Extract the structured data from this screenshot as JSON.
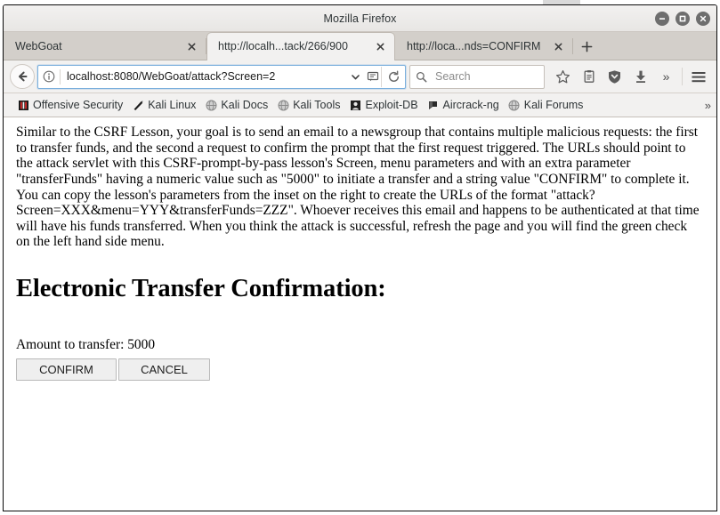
{
  "window": {
    "title": "Mozilla Firefox",
    "controls": [
      {
        "name": "minimize",
        "glyph": "minimize-icon"
      },
      {
        "name": "maximize",
        "glyph": "maximize-icon"
      },
      {
        "name": "close",
        "glyph": "close-icon"
      }
    ]
  },
  "tabs": [
    {
      "label": "WebGoat",
      "active": false,
      "close": "×"
    },
    {
      "label": "http://localh...tack/266/900",
      "active": true,
      "close": "×"
    },
    {
      "label": "http://loca...nds=CONFIRM",
      "active": false,
      "close": "×"
    }
  ],
  "new_tab_label": "+",
  "navigation": {
    "back_icon": "back-arrow-icon",
    "identity_icon": "info-icon",
    "url_value": "localhost:8080/WebGoat/attack?Screen=2",
    "url_dropdown_icon": "chevron-down-icon",
    "url_page_action_icon": "page-action-icon",
    "reload_icon": "reload-icon",
    "search_placeholder": "Search",
    "search_icon": "search-icon",
    "bookmark_icon": "star-icon",
    "library_icon": "library-icon",
    "sync_icon": "shield-down-icon",
    "downloads_icon": "download-arrow-icon",
    "overflow_icon": "»",
    "menu_icon": "hamburger-menu-icon"
  },
  "bookmarks": {
    "items": [
      {
        "label": "Offensive Security",
        "icon": "offsec-icon"
      },
      {
        "label": "Kali Linux",
        "icon": "kali-dragon-icon"
      },
      {
        "label": "Kali Docs",
        "icon": "globe-icon"
      },
      {
        "label": "Kali Tools",
        "icon": "globe-icon"
      },
      {
        "label": "Exploit-DB",
        "icon": "exploitdb-icon"
      },
      {
        "label": "Aircrack-ng",
        "icon": "aircrack-icon"
      },
      {
        "label": "Kali Forums",
        "icon": "globe-icon"
      }
    ],
    "overflow": "»"
  },
  "page": {
    "lesson_description": "Similar to the CSRF Lesson, your goal is to send an email to a newsgroup that contains multiple malicious requests: the first to transfer funds, and the second a request to confirm the prompt that the first request triggered. The URLs should point to the attack servlet with this CSRF-prompt-by-pass lesson's Screen, menu parameters and with an extra parameter \"transferFunds\" having a numeric value such as \"5000\" to initiate a transfer and a string value \"CONFIRM\" to complete it. You can copy the lesson's parameters from the inset on the right to create the URLs of the format \"attack?Screen=XXX&menu=YYY&transferFunds=ZZZ\". Whoever receives this email and happens to be authenticated at that time will have his funds transferred. When you think the attack is successful, refresh the page and you will find the green check on the left hand side menu.",
    "heading": "Electronic Transfer Confirmation:",
    "amount_label": "Amount to transfer: 5000",
    "confirm_button": "CONFIRM",
    "cancel_button": "CANCEL"
  },
  "colors": {
    "chrome_bg": "#f2f1f0",
    "tabstrip_bg": "#d3cfca",
    "url_focus_border": "#7cb0dd",
    "content_bg": "#ffffff",
    "text": "#000000"
  }
}
